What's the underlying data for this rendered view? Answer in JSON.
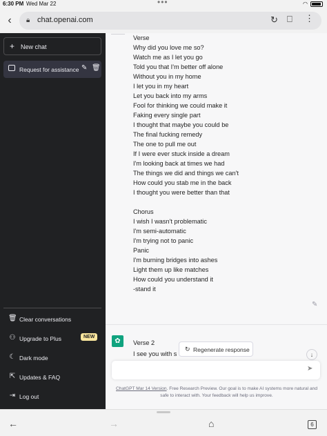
{
  "status": {
    "time": "6:30 PM",
    "date": "Wed Mar 22"
  },
  "browser": {
    "url": "chat.openai.com"
  },
  "sidebar": {
    "new_chat": "New chat",
    "conversations": [
      {
        "title": "Request for assistance"
      }
    ],
    "bottom_items": [
      {
        "label": "Clear conversations",
        "icon": "trash-icon"
      },
      {
        "label": "Upgrade to Plus",
        "icon": "user-icon",
        "badge": "NEW"
      },
      {
        "label": "Dark mode",
        "icon": "moon-icon"
      },
      {
        "label": "Updates & FAQ",
        "icon": "external-link-icon"
      },
      {
        "label": "Log out",
        "icon": "logout-icon"
      }
    ]
  },
  "conversation": {
    "assistant_reply_lines": [
      "Verse",
      "Why did you love me so?",
      "Watch me as I let you go",
      "Told you that I'm better off alone",
      "Without you in my home",
      "I let you in my heart",
      "Let you back into my arms",
      "Fool for thinking we could make it",
      "Faking every single part",
      "I thought that maybe you could be",
      "The final fucking remedy",
      "The one to pull me out",
      "If I were ever stuck inside a dream",
      "I'm looking back at times we had",
      "The things we did and things we can't",
      "How could you stab me in the back",
      "I thought you were better than that",
      "",
      "Chorus",
      "I wish I wasn't problematic",
      "I'm semi-automatic",
      "I'm trying not to panic",
      "Panic",
      "I'm burning bridges into ashes",
      "Light them up like matches",
      "How could you understand it",
      "-stand it"
    ],
    "next_message_lines": [
      "Verse 2",
      "I see you with s"
    ],
    "regenerate_label": "Regenerate response"
  },
  "composer": {
    "placeholder": ""
  },
  "footer": {
    "link": "ChatGPT Mar 14 Version",
    "text": ". Free Research Preview. Our goal is to make AI systems more natural and safe to interact with. Your feedback will help us improve."
  },
  "toolbar": {
    "tab_count": "6"
  },
  "colors": {
    "sidebar_bg": "#202123",
    "main_bg": "#f7f7f8",
    "accent": "#10a37f",
    "badge": "#fae69e"
  }
}
